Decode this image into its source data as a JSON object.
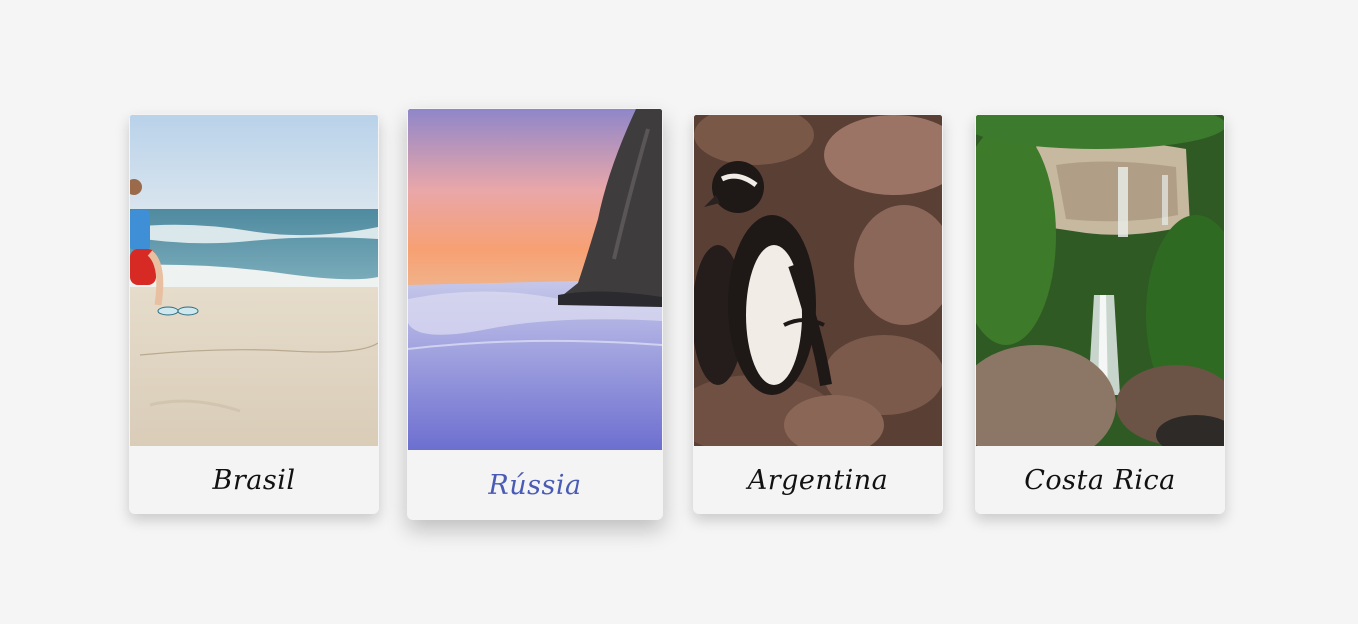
{
  "cards": [
    {
      "label": "Brasil",
      "image": "beach-boy-photo",
      "active": false
    },
    {
      "label": "Rússia",
      "image": "sunset-snow-cliff-photo",
      "active": true
    },
    {
      "label": "Argentina",
      "image": "penguins-rocks-photo",
      "active": false
    },
    {
      "label": "Costa Rica",
      "image": "waterfall-jungle-photo",
      "active": false
    }
  ],
  "colors": {
    "background": "#f5f5f5",
    "caption_text": "#111111",
    "active_caption_text": "#4a5bb5"
  }
}
